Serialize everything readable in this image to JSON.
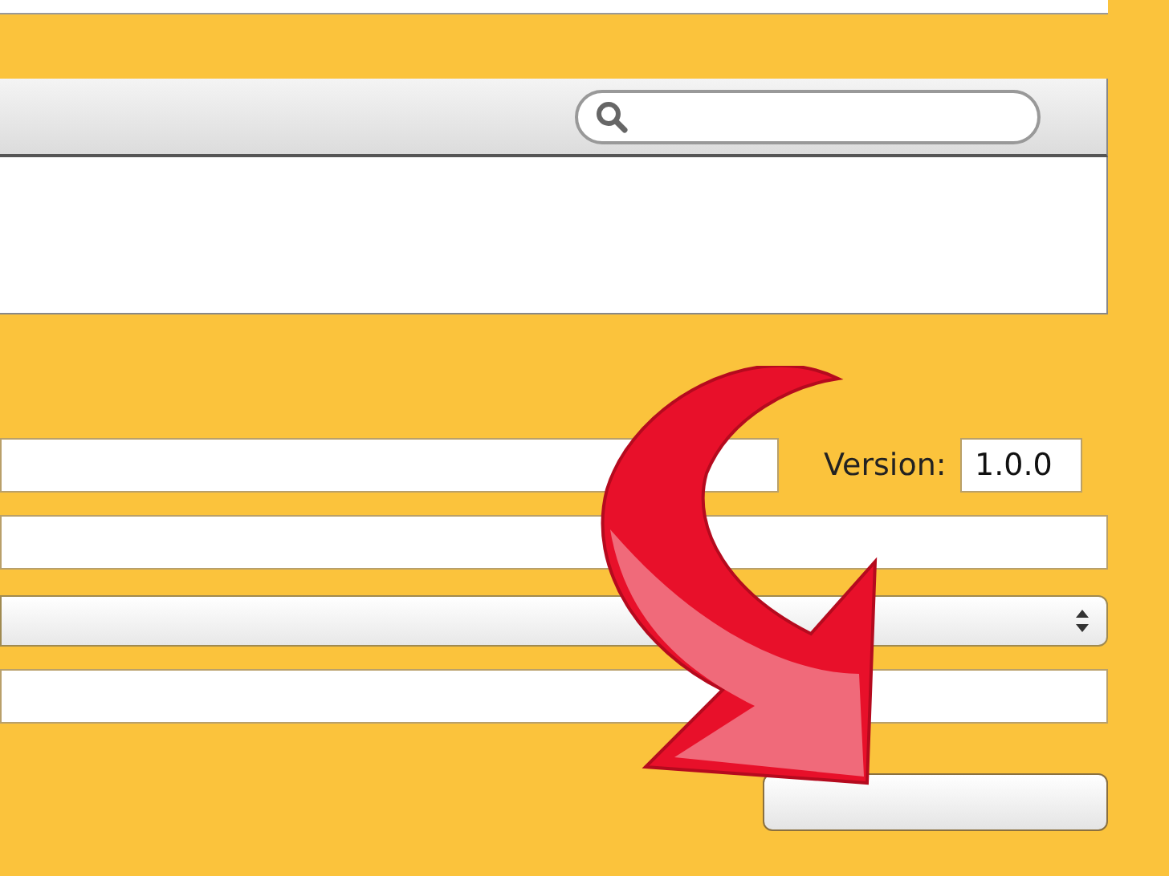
{
  "version": {
    "label": "Version:",
    "value": "1.0.0"
  },
  "select": {
    "kind": "popup"
  }
}
